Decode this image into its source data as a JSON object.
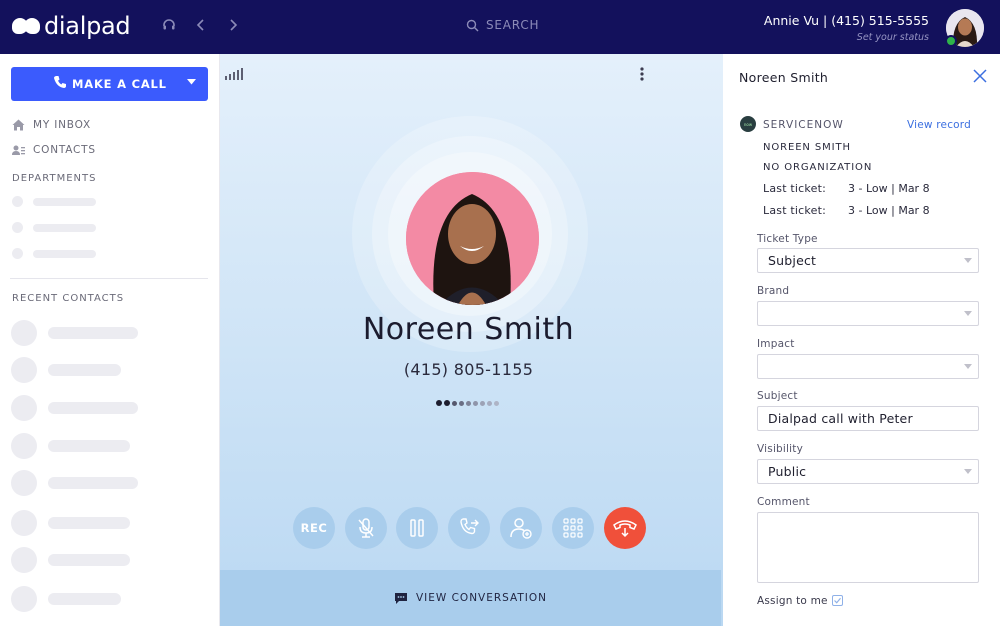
{
  "app": {
    "logo_text": "dialpad"
  },
  "topbar": {
    "search_label": "SEARCH",
    "user_name": "Annie Vu | (415) 515-5555",
    "user_status": "Set your status"
  },
  "sidebar": {
    "make_call_label": "MAKE A CALL",
    "items": [
      {
        "label": "MY INBOX"
      },
      {
        "label": "CONTACTS"
      }
    ],
    "departments_heading": "DEPARTMENTS",
    "recent_contacts_heading": "RECENT CONTACTS"
  },
  "call": {
    "caller_name": "Noreen Smith",
    "caller_number": "(415) 805-1155",
    "rec_label": "REC",
    "view_conversation_label": "VIEW CONVERSATION"
  },
  "panel": {
    "title": "Noreen Smith",
    "servicenow_label": "SERVICENOW",
    "view_record_label": "View record",
    "contact_name": "NOREEN SMITH",
    "organization": "NO ORGANIZATION",
    "tickets": [
      {
        "label": "Last ticket:",
        "value": "3 - Low | Mar 8"
      },
      {
        "label": "Last ticket:",
        "value": "3 - Low | Mar 8"
      }
    ],
    "fields": {
      "ticket_type": {
        "label": "Ticket Type",
        "value": "Subject"
      },
      "brand": {
        "label": "Brand",
        "value": ""
      },
      "impact": {
        "label": "Impact",
        "value": ""
      },
      "subject": {
        "label": "Subject",
        "value": "Dialpad call with Peter"
      },
      "visibility": {
        "label": "Visibility",
        "value": "Public"
      },
      "comment": {
        "label": "Comment",
        "value": ""
      }
    },
    "assign_label": "Assign to me",
    "assign_checked": false
  },
  "colors": {
    "topbar_bg": "#13115c",
    "accent": "#3b5bfd",
    "hangup": "#f0503a",
    "avatar_bg": "#f38aa4"
  }
}
